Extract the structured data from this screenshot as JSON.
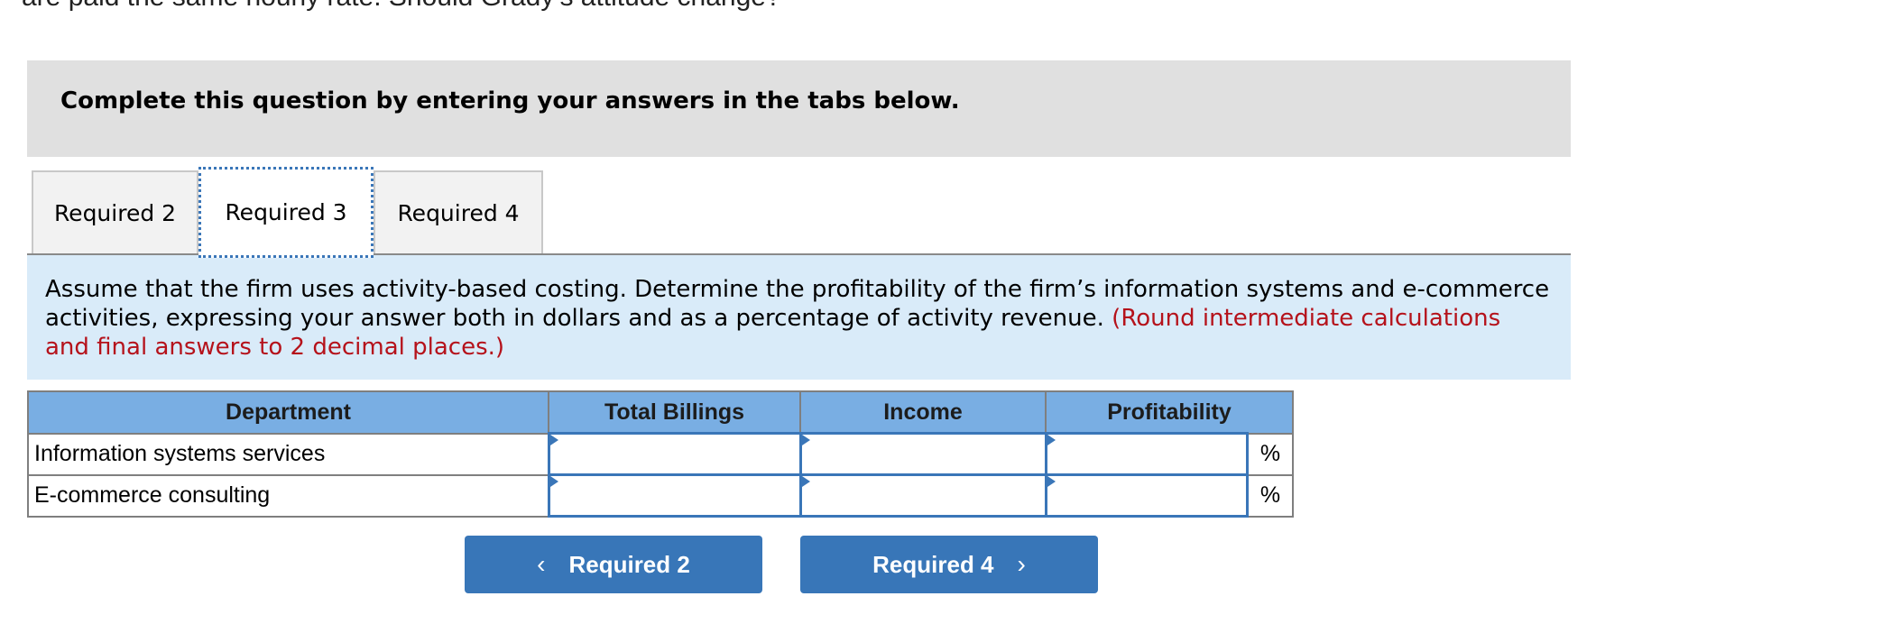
{
  "question_tail": "are paid the same hourly rate.  Should Grady’s attitude change?",
  "instruction": "Complete this question by entering your answers in the tabs below.",
  "tabs": [
    {
      "label": "Required 2",
      "active": false
    },
    {
      "label": "Required 3",
      "active": true
    },
    {
      "label": "Required 4",
      "active": false
    }
  ],
  "panel": {
    "text": "Assume that the firm uses activity-based costing. Determine the profitability of the firm’s information systems and e-commerce activities, expressing your answer both in dollars and as a percentage of activity revenue.",
    "note": "(Round intermediate calculations and final answers to 2 decimal places.)"
  },
  "table": {
    "headers": [
      "Department",
      "Total Billings",
      "Income",
      "Profitability"
    ],
    "rows": [
      {
        "department": "Information systems services",
        "total_billings": "",
        "income": "",
        "profitability": "",
        "unit": "%"
      },
      {
        "department": "E-commerce consulting",
        "total_billings": "",
        "income": "",
        "profitability": "",
        "unit": "%"
      }
    ]
  },
  "nav": {
    "prev_label": "Required 2",
    "next_label": "Required 4",
    "prev_icon": "chevron-left-icon",
    "next_icon": "chevron-right-icon"
  },
  "colors": {
    "accent": "#3876b8",
    "header_bg": "#79aee3",
    "panel_bg": "#d9ebf9",
    "note_red": "#b5121b"
  }
}
